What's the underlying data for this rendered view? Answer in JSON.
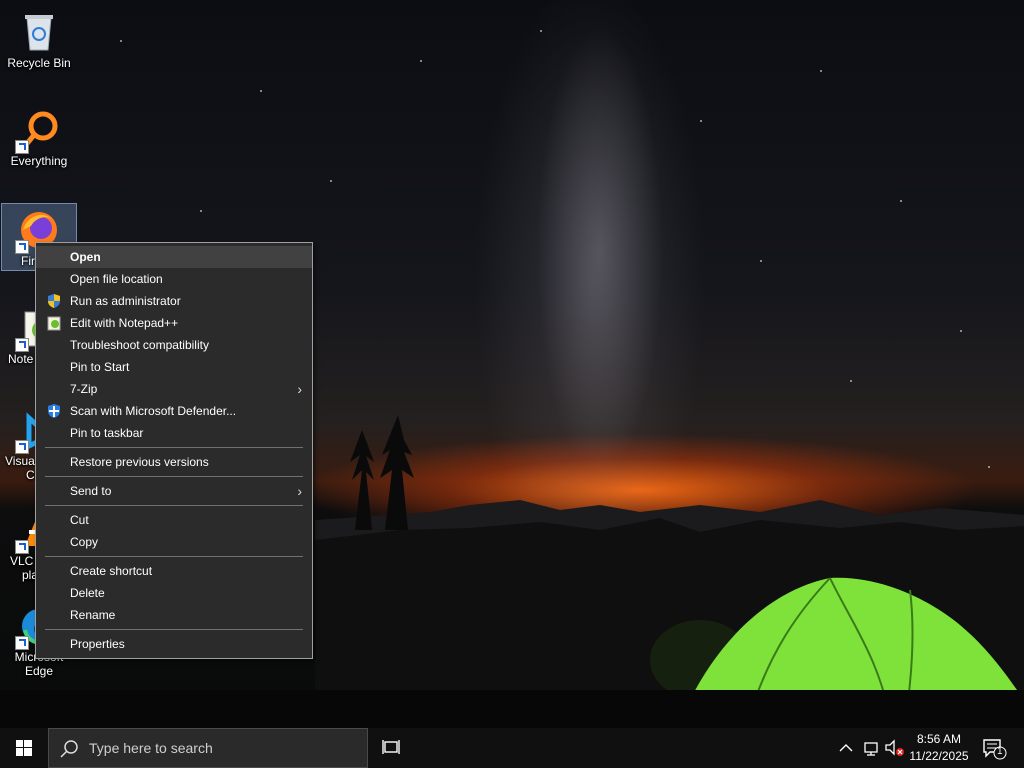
{
  "desktop": {
    "icons": [
      {
        "label": "Recycle Bin",
        "icon": "recycle-bin-icon"
      },
      {
        "label": "Everything",
        "icon": "everything-search-icon"
      },
      {
        "label": "Firefox",
        "icon": "firefox-icon"
      },
      {
        "label": "Notepad++",
        "icon": "notepad-plus-plus-icon"
      },
      {
        "label": "Visual Studio Code",
        "icon": "vscode-icon"
      },
      {
        "label": "VLC media player",
        "icon": "vlc-icon"
      },
      {
        "label": "Microsoft Edge",
        "icon": "edge-icon"
      }
    ],
    "visible_labels": [
      "Recycle Bin",
      "Everything",
      "Fir",
      "Note",
      "Visua",
      "Co",
      "VLC",
      "pla",
      "Microsoft",
      "Edge"
    ]
  },
  "context_menu": {
    "items": [
      {
        "label": "Open",
        "bold": true,
        "highlighted": true
      },
      {
        "label": "Open file location"
      },
      {
        "label": "Run as administrator",
        "icon": "uac-shield-icon"
      },
      {
        "label": "Edit with Notepad++",
        "icon": "notepad-plus-plus-icon"
      },
      {
        "label": "Troubleshoot compatibility"
      },
      {
        "label": "Pin to Start"
      },
      {
        "label": "7-Zip",
        "submenu": true
      },
      {
        "label": "Scan with Microsoft Defender...",
        "icon": "defender-shield-icon"
      },
      {
        "label": "Pin to taskbar"
      },
      {
        "label": "Restore previous versions"
      },
      {
        "label": "Send to",
        "submenu": true
      },
      {
        "label": "Cut"
      },
      {
        "label": "Copy"
      },
      {
        "label": "Create shortcut"
      },
      {
        "label": "Delete"
      },
      {
        "label": "Rename"
      },
      {
        "label": "Properties"
      }
    ],
    "submenu_arrow": "›"
  },
  "taskbar": {
    "search_placeholder": "Type here to search",
    "time": "8:56 AM",
    "date": "11/22/2025",
    "notification_count": "1"
  },
  "colors": {
    "menu_bg": "#2b2b2b",
    "menu_highlight": "#414141",
    "taskbar_bg": "#101010",
    "tent_green": "#7ee23a"
  }
}
